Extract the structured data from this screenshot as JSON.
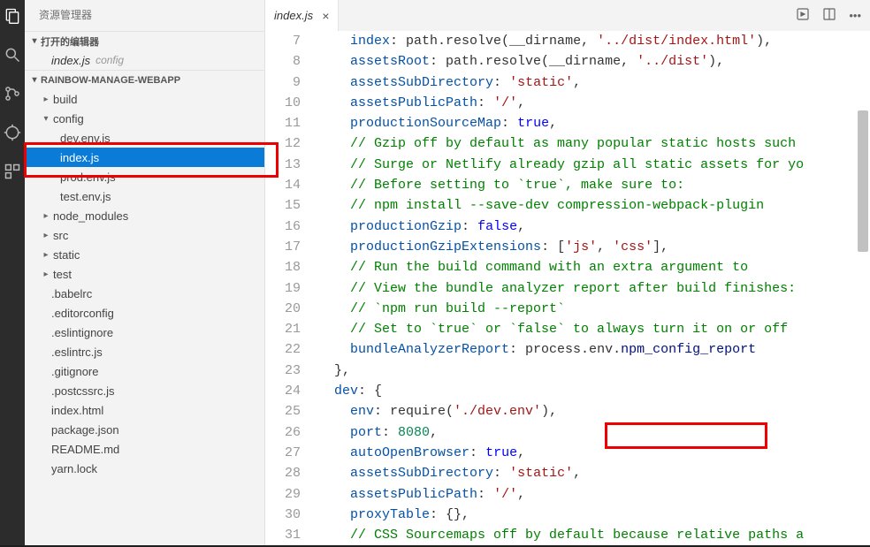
{
  "sidebar": {
    "title": "资源管理器",
    "openEditorsHeader": "打开的编辑器",
    "openItem": {
      "name": "index.js",
      "tag": "config"
    },
    "projectHeader": "RAINBOW-MANAGE-WEBAPP",
    "tree": [
      {
        "indent": 18,
        "chev": "▸",
        "label": "build"
      },
      {
        "indent": 18,
        "chev": "▾",
        "label": "config"
      },
      {
        "indent": 40,
        "chev": "",
        "label": "dev.env.js"
      },
      {
        "indent": 40,
        "chev": "",
        "label": "index.js",
        "selected": true
      },
      {
        "indent": 40,
        "chev": "",
        "label": "prod.env.js"
      },
      {
        "indent": 40,
        "chev": "",
        "label": "test.env.js"
      },
      {
        "indent": 18,
        "chev": "▸",
        "label": "node_modules"
      },
      {
        "indent": 18,
        "chev": "▸",
        "label": "src"
      },
      {
        "indent": 18,
        "chev": "▸",
        "label": "static"
      },
      {
        "indent": 18,
        "chev": "▸",
        "label": "test"
      },
      {
        "indent": 30,
        "chev": "",
        "label": ".babelrc"
      },
      {
        "indent": 30,
        "chev": "",
        "label": ".editorconfig"
      },
      {
        "indent": 30,
        "chev": "",
        "label": ".eslintignore"
      },
      {
        "indent": 30,
        "chev": "",
        "label": ".eslintrc.js"
      },
      {
        "indent": 30,
        "chev": "",
        "label": ".gitignore"
      },
      {
        "indent": 30,
        "chev": "",
        "label": ".postcssrc.js"
      },
      {
        "indent": 30,
        "chev": "",
        "label": "index.html"
      },
      {
        "indent": 30,
        "chev": "",
        "label": "package.json"
      },
      {
        "indent": 30,
        "chev": "",
        "label": "README.md"
      },
      {
        "indent": 30,
        "chev": "",
        "label": "yarn.lock"
      }
    ]
  },
  "tabs": {
    "active": "index.js"
  },
  "code": {
    "startLine": 7,
    "lines": [
      [
        {
          "t": "    "
        },
        {
          "t": "index",
          "c": "tk-prop"
        },
        {
          "t": ": path.resolve(__dirname, "
        },
        {
          "t": "'../dist/index.html'",
          "c": "tk-str"
        },
        {
          "t": "),"
        }
      ],
      [
        {
          "t": "    "
        },
        {
          "t": "assetsRoot",
          "c": "tk-prop"
        },
        {
          "t": ": path.resolve(__dirname, "
        },
        {
          "t": "'../dist'",
          "c": "tk-str"
        },
        {
          "t": "),"
        }
      ],
      [
        {
          "t": "    "
        },
        {
          "t": "assetsSubDirectory",
          "c": "tk-prop"
        },
        {
          "t": ": "
        },
        {
          "t": "'static'",
          "c": "tk-str"
        },
        {
          "t": ","
        }
      ],
      [
        {
          "t": "    "
        },
        {
          "t": "assetsPublicPath",
          "c": "tk-prop"
        },
        {
          "t": ": "
        },
        {
          "t": "'/'",
          "c": "tk-str"
        },
        {
          "t": ","
        }
      ],
      [
        {
          "t": "    "
        },
        {
          "t": "productionSourceMap",
          "c": "tk-prop"
        },
        {
          "t": ": "
        },
        {
          "t": "true",
          "c": "tk-kw"
        },
        {
          "t": ","
        }
      ],
      [
        {
          "t": "    "
        },
        {
          "t": "// Gzip off by default as many popular static hosts such",
          "c": "tk-comment"
        }
      ],
      [
        {
          "t": "    "
        },
        {
          "t": "// Surge or Netlify already gzip all static assets for yo",
          "c": "tk-comment"
        }
      ],
      [
        {
          "t": "    "
        },
        {
          "t": "// Before setting to `true`, make sure to:",
          "c": "tk-comment"
        }
      ],
      [
        {
          "t": "    "
        },
        {
          "t": "// npm install --save-dev compression-webpack-plugin",
          "c": "tk-comment"
        }
      ],
      [
        {
          "t": "    "
        },
        {
          "t": "productionGzip",
          "c": "tk-prop"
        },
        {
          "t": ": "
        },
        {
          "t": "false",
          "c": "tk-kw"
        },
        {
          "t": ","
        }
      ],
      [
        {
          "t": "    "
        },
        {
          "t": "productionGzipExtensions",
          "c": "tk-prop"
        },
        {
          "t": ": ["
        },
        {
          "t": "'js'",
          "c": "tk-str"
        },
        {
          "t": ", "
        },
        {
          "t": "'css'",
          "c": "tk-str"
        },
        {
          "t": "],"
        }
      ],
      [
        {
          "t": "    "
        },
        {
          "t": "// Run the build command with an extra argument to",
          "c": "tk-comment"
        }
      ],
      [
        {
          "t": "    "
        },
        {
          "t": "// View the bundle analyzer report after build finishes:",
          "c": "tk-comment"
        }
      ],
      [
        {
          "t": "    "
        },
        {
          "t": "// `npm run build --report`",
          "c": "tk-comment"
        }
      ],
      [
        {
          "t": "    "
        },
        {
          "t": "// Set to `true` or `false` to always turn it on or off",
          "c": "tk-comment"
        }
      ],
      [
        {
          "t": "    "
        },
        {
          "t": "bundleAnalyzerReport",
          "c": "tk-prop"
        },
        {
          "t": ": process.env."
        },
        {
          "t": "npm_config_report",
          "c": "tk-ident"
        }
      ],
      [
        {
          "t": "  },"
        }
      ],
      [
        {
          "t": "  "
        },
        {
          "t": "dev",
          "c": "tk-prop"
        },
        {
          "t": ": {"
        }
      ],
      [
        {
          "t": "    "
        },
        {
          "t": "env",
          "c": "tk-prop"
        },
        {
          "t": ": require("
        },
        {
          "t": "'./dev.env'",
          "c": "tk-str"
        },
        {
          "t": "),"
        }
      ],
      [
        {
          "t": "    "
        },
        {
          "t": "port",
          "c": "tk-prop"
        },
        {
          "t": ": "
        },
        {
          "t": "8080",
          "c": "tk-num"
        },
        {
          "t": ","
        }
      ],
      [
        {
          "t": "    "
        },
        {
          "t": "autoOpenBrowser",
          "c": "tk-prop"
        },
        {
          "t": ": "
        },
        {
          "t": "true",
          "c": "tk-kw"
        },
        {
          "t": ","
        }
      ],
      [
        {
          "t": "    "
        },
        {
          "t": "assetsSubDirectory",
          "c": "tk-prop"
        },
        {
          "t": ": "
        },
        {
          "t": "'static'",
          "c": "tk-str"
        },
        {
          "t": ","
        }
      ],
      [
        {
          "t": "    "
        },
        {
          "t": "assetsPublicPath",
          "c": "tk-prop"
        },
        {
          "t": ": "
        },
        {
          "t": "'/'",
          "c": "tk-str"
        },
        {
          "t": ","
        }
      ],
      [
        {
          "t": "    "
        },
        {
          "t": "proxyTable",
          "c": "tk-prop"
        },
        {
          "t": ": {},"
        }
      ],
      [
        {
          "t": "    "
        },
        {
          "t": "// CSS Sourcemaps off by default because relative paths a",
          "c": "tk-comment"
        }
      ]
    ]
  }
}
